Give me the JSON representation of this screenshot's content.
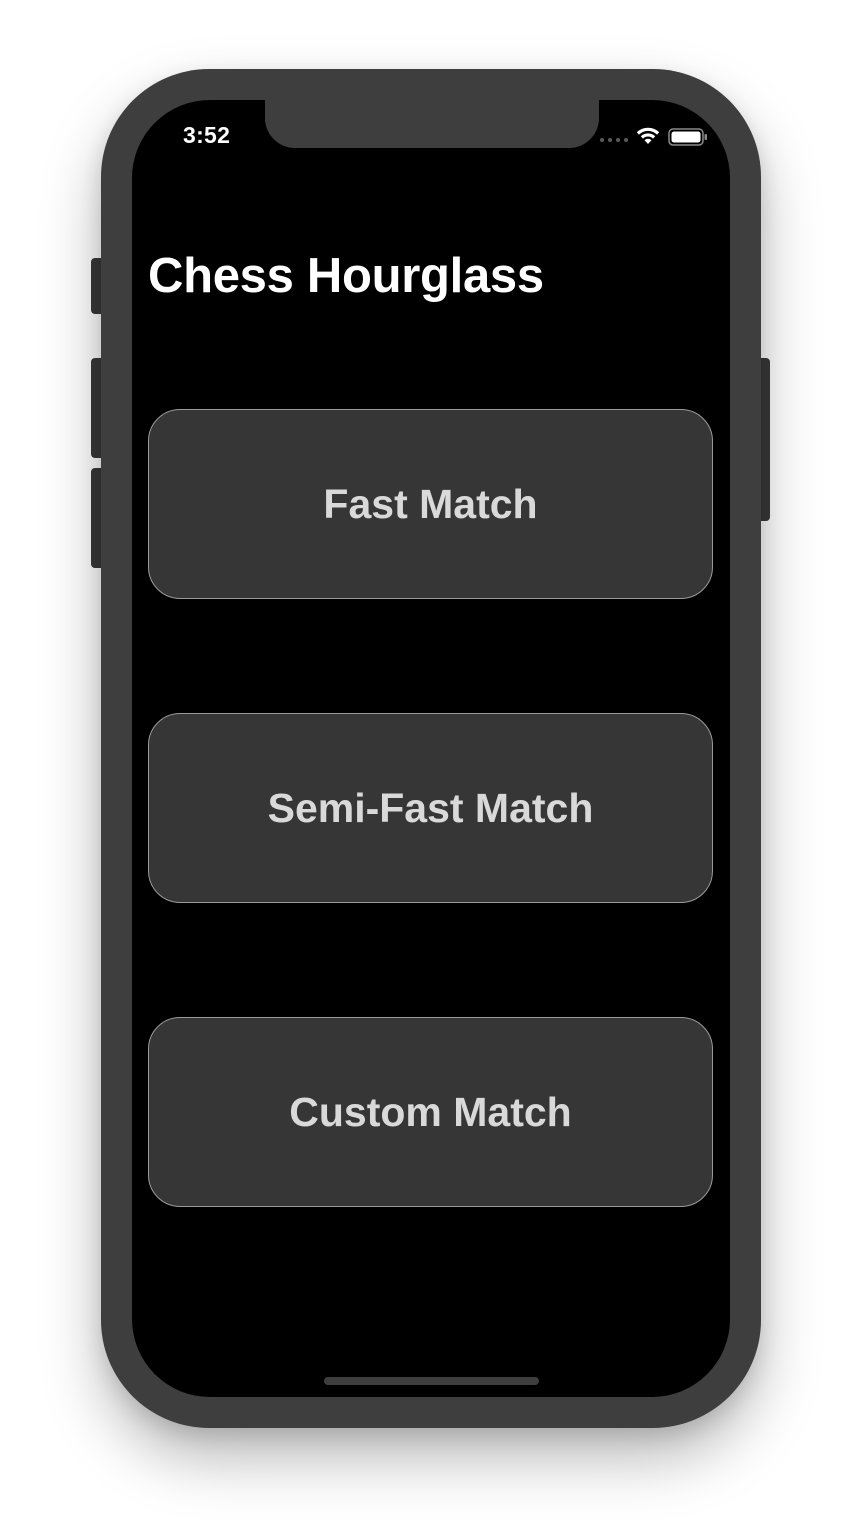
{
  "status_bar": {
    "time": "3:52",
    "icons": [
      "cellular-signal-icon",
      "wifi-icon",
      "battery-icon"
    ]
  },
  "nav": {
    "title": "Chess Hourglass"
  },
  "menu": {
    "buttons": [
      {
        "label": "Fast Match"
      },
      {
        "label": "Semi-Fast Match"
      },
      {
        "label": "Custom Match"
      }
    ]
  },
  "colors": {
    "background": "#000000",
    "device_frame": "#3e3e3e",
    "button_fill": "#363636",
    "button_border": "#9a9a9a",
    "button_text": "#d9d9d9",
    "title_text": "#ffffff"
  }
}
